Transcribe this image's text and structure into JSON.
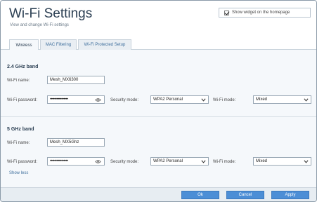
{
  "header": {
    "title": "Wi-Fi Settings",
    "subtitle": "View and change Wi-Fi settings",
    "widget_label": "Show widget on the homepage"
  },
  "tabs": [
    {
      "label": "Wireless"
    },
    {
      "label": "MAC Filtering"
    },
    {
      "label": "Wi-Fi Protected Setup"
    }
  ],
  "band24": {
    "title": "2.4 GHz band",
    "name_label": "Wi-Fi name:",
    "name_value": "Mesh_MX6300",
    "password_label": "Wi-Fi password:",
    "password_value": "••••••••••••••••",
    "security_label": "Security mode:",
    "security_value": "WPA2 Personal",
    "mode_label": "Wi-Fi mode:",
    "mode_value": "Mixed"
  },
  "band5": {
    "title": "5 GHz band",
    "name_label": "Wi-Fi name:",
    "name_value": "Mesh_MX5Ghz",
    "password_label": "Wi-Fi password:",
    "password_value": "••••••••••••••••",
    "security_label": "Security mode:",
    "security_value": "WPA2 Personal",
    "mode_label": "Wi-Fi mode:",
    "mode_value": "Mixed"
  },
  "show_less": "Show less",
  "buttons": {
    "ok": "Ok",
    "cancel": "Cancel",
    "apply": "Apply"
  },
  "colors": {
    "accent": "#4c8ed6",
    "title": "#2a3e52",
    "link": "#3f6f9d"
  },
  "icons": {
    "checkbox": "checked-checkbox-icon",
    "eye": "eye-icon",
    "dropdown": "chevron-down-icon"
  }
}
